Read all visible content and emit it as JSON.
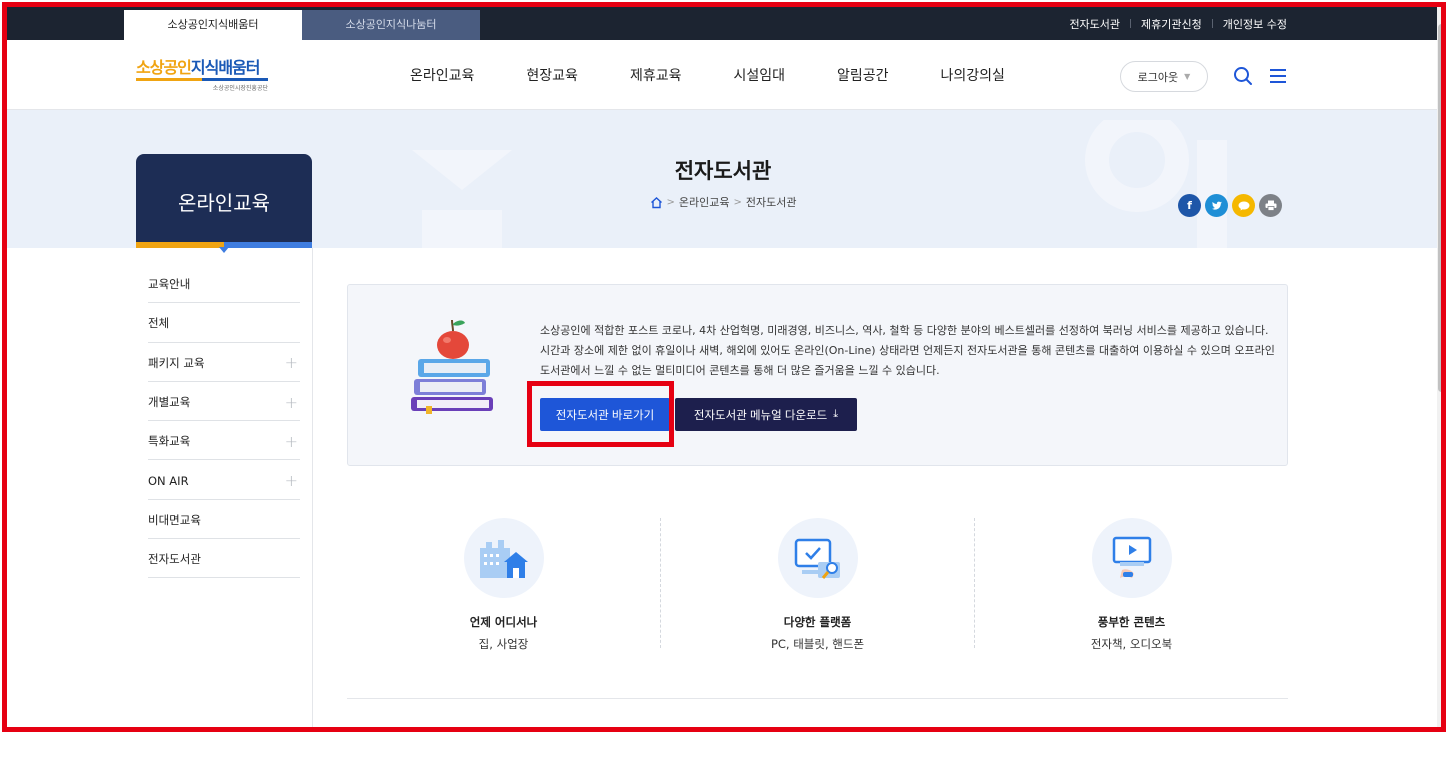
{
  "topbar": {
    "site_tabs": [
      {
        "label": "소상공인지식배움터",
        "active": true
      },
      {
        "label": "소상공인지식나눔터",
        "active": false
      }
    ],
    "util_links": [
      "전자도서관",
      "제휴기관신청",
      "개인정보 수정"
    ]
  },
  "header": {
    "logo": {
      "part1": "소상공인",
      "part2": "지식배움터",
      "sub": "소상공인시장진흥공단"
    },
    "nav": [
      "온라인교육",
      "현장교육",
      "제휴교육",
      "시설임대",
      "알림공간",
      "나의강의실"
    ],
    "logout_label": "로그아웃",
    "icons": [
      "search-icon",
      "menu-icon"
    ]
  },
  "hero": {
    "title": "전자도서관",
    "breadcrumb": [
      "온라인교육",
      "전자도서관"
    ],
    "share_icons": [
      {
        "name": "facebook-icon",
        "color": "#1e56a8"
      },
      {
        "name": "twitter-icon",
        "color": "#1f8fd6"
      },
      {
        "name": "kakaotalk-icon",
        "color": "#f5b800"
      },
      {
        "name": "print-icon",
        "color": "#7d8187"
      }
    ]
  },
  "sidebar": {
    "title": "온라인교육",
    "items": [
      {
        "label": "교육안내",
        "expandable": false
      },
      {
        "label": "전체",
        "expandable": false
      },
      {
        "label": "패키지 교육",
        "expandable": true
      },
      {
        "label": "개별교육",
        "expandable": true
      },
      {
        "label": "특화교육",
        "expandable": true
      },
      {
        "label": "ON AIR",
        "expandable": true
      },
      {
        "label": "비대면교육",
        "expandable": false
      },
      {
        "label": "전자도서관",
        "expandable": false
      }
    ]
  },
  "intro": {
    "description": "소상공인에 적합한 포스트 코로나, 4차 산업혁명, 미래경영, 비즈니스, 역사, 철학 등 다양한 분야의 베스트셀러를 선정하여 북러닝 서비스를 제공하고 있습니다. 시간과 장소에 제한 없이 휴일이나 새벽, 해외에 있어도 온라인(On-Line) 상태라면 언제든지 전자도서관을 통해 콘텐츠를 대출하여 이용하실 수 있으며 오프라인 도서관에서 느낄 수 없는 멀티미디어 콘텐츠를 통해 더 많은 즐거움을 느낄 수 있습니다.",
    "go_button": "전자도서관 바로가기",
    "download_button": "전자도서관 메뉴얼 다운로드"
  },
  "features": [
    {
      "icon": "building-home-icon",
      "title": "언제 어디서나",
      "subtitle": "집, 사업장"
    },
    {
      "icon": "monitor-check-icon",
      "title": "다양한 플랫폼",
      "subtitle": "PC, 태블릿, 핸드폰"
    },
    {
      "icon": "video-screen-icon",
      "title": "풍부한 콘텐츠",
      "subtitle": "전자책, 오디오북"
    }
  ],
  "colors": {
    "topbar_bg": "#1c2431",
    "sidebar_head_bg": "#1d2d55",
    "primary_button": "#1e56d8",
    "dark_button": "#1d1f4d",
    "annotation_red": "#e60012",
    "hero_bg": "#eaf0f9"
  }
}
